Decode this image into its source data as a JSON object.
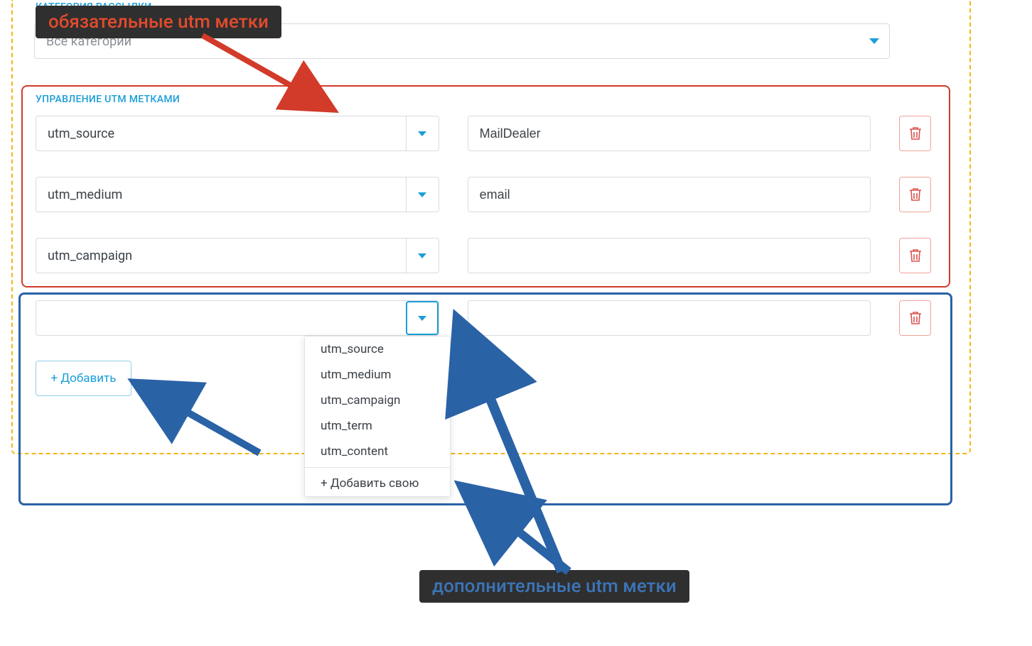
{
  "labels": {
    "category_section": "КАТЕГОРИЯ РАССЫЛКИ",
    "category_value": "Все категории",
    "utm_section": "УПРАВЛЕНИЕ UTM МЕТКАМИ"
  },
  "rows": [
    {
      "key": "utm_source",
      "value": "MailDealer"
    },
    {
      "key": "utm_medium",
      "value": "email"
    },
    {
      "key": "utm_campaign",
      "value": ""
    },
    {
      "key": "",
      "value": ""
    }
  ],
  "dropdown": {
    "options": [
      "utm_source",
      "utm_medium",
      "utm_campaign",
      "utm_term",
      "utm_content"
    ],
    "add_custom": "+ Добавить свою"
  },
  "add_button": "+ Добавить",
  "callouts": {
    "required": "обязательные utm метки",
    "additional": "дополнительные utm метки"
  }
}
